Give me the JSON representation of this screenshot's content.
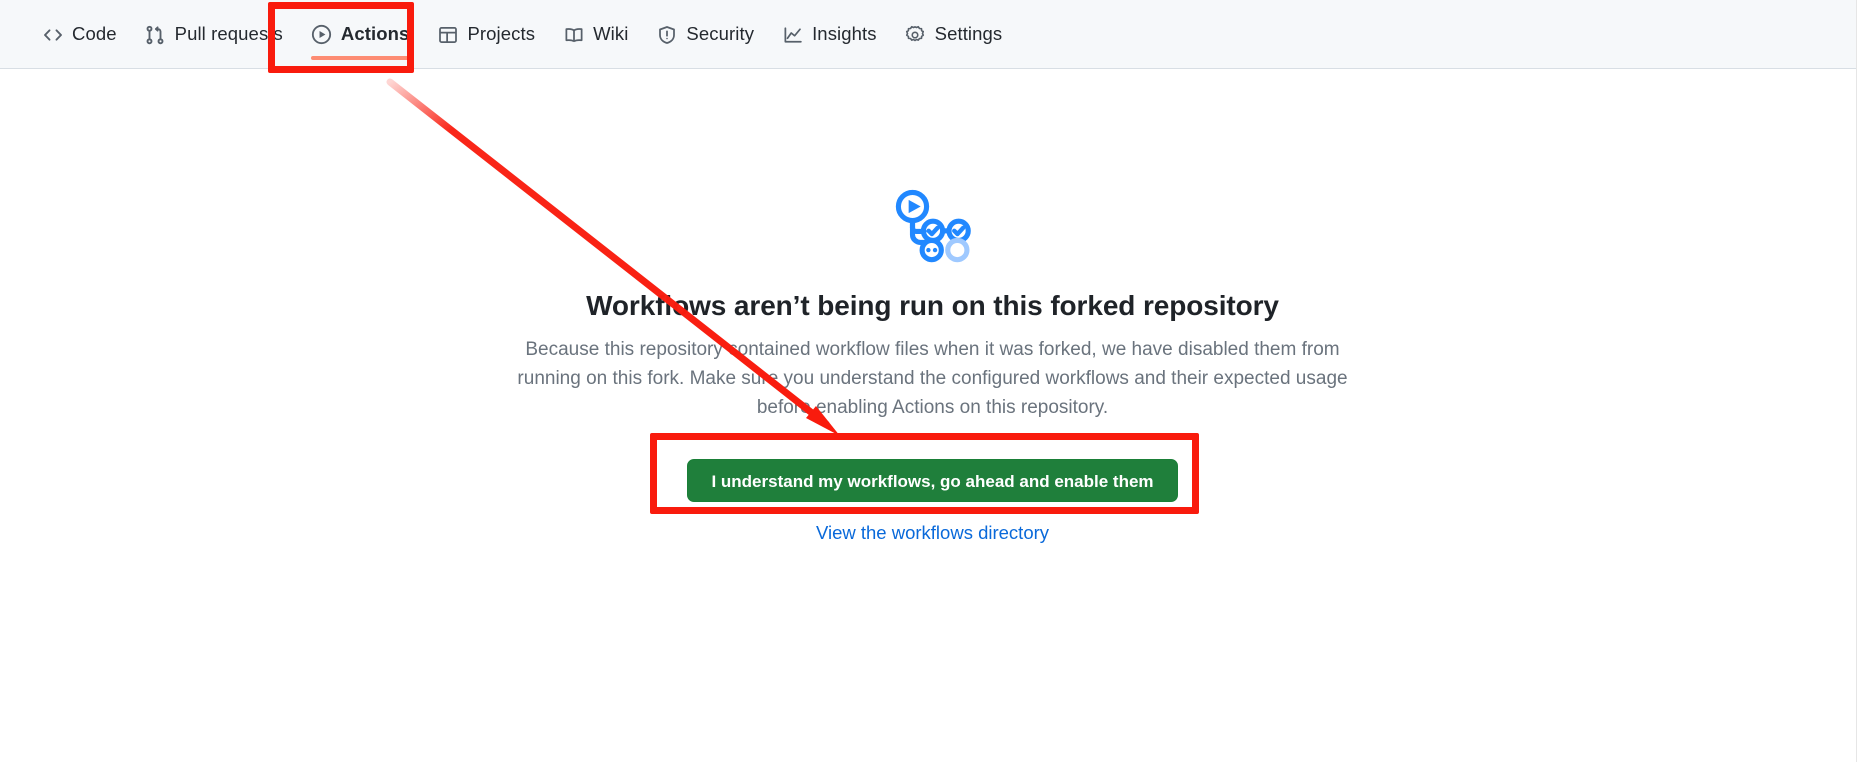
{
  "repo_nav": {
    "items": [
      {
        "label": "Code",
        "icon": "code-icon",
        "selected": false
      },
      {
        "label": "Pull requests",
        "icon": "git-pull-request-icon",
        "selected": false
      },
      {
        "label": "Actions",
        "icon": "play-circle-icon",
        "selected": true
      },
      {
        "label": "Projects",
        "icon": "table-icon",
        "selected": false
      },
      {
        "label": "Wiki",
        "icon": "book-icon",
        "selected": false
      },
      {
        "label": "Security",
        "icon": "shield-icon",
        "selected": false
      },
      {
        "label": "Insights",
        "icon": "graph-icon",
        "selected": false
      },
      {
        "label": "Settings",
        "icon": "gear-icon",
        "selected": false
      }
    ],
    "selected_underline_color": "#fd8c73"
  },
  "blankslate": {
    "logo_icon": "github-actions-logo",
    "heading": "Workflows aren’t being run on this forked repository",
    "description": "Because this repository contained workflow files when it was forked, we have disabled them from running on this fork. Make sure you understand the configured workflows and their expected usage before enabling Actions on this repository.",
    "primary_button_label": "I understand my workflows, go ahead and enable them",
    "primary_button_color": "#1f7f3b",
    "link_label": "View the workflows directory",
    "link_color": "#0969da"
  },
  "annotations": {
    "color": "#f91b0d",
    "boxes": [
      {
        "name": "actions-tab-highlight",
        "target": "Actions"
      },
      {
        "name": "enable-button-highlight",
        "target": "I understand my workflows, go ahead and enable them"
      }
    ],
    "arrow": {
      "from": "Actions tab",
      "to": "I understand my workflows, go ahead and enable them"
    }
  }
}
